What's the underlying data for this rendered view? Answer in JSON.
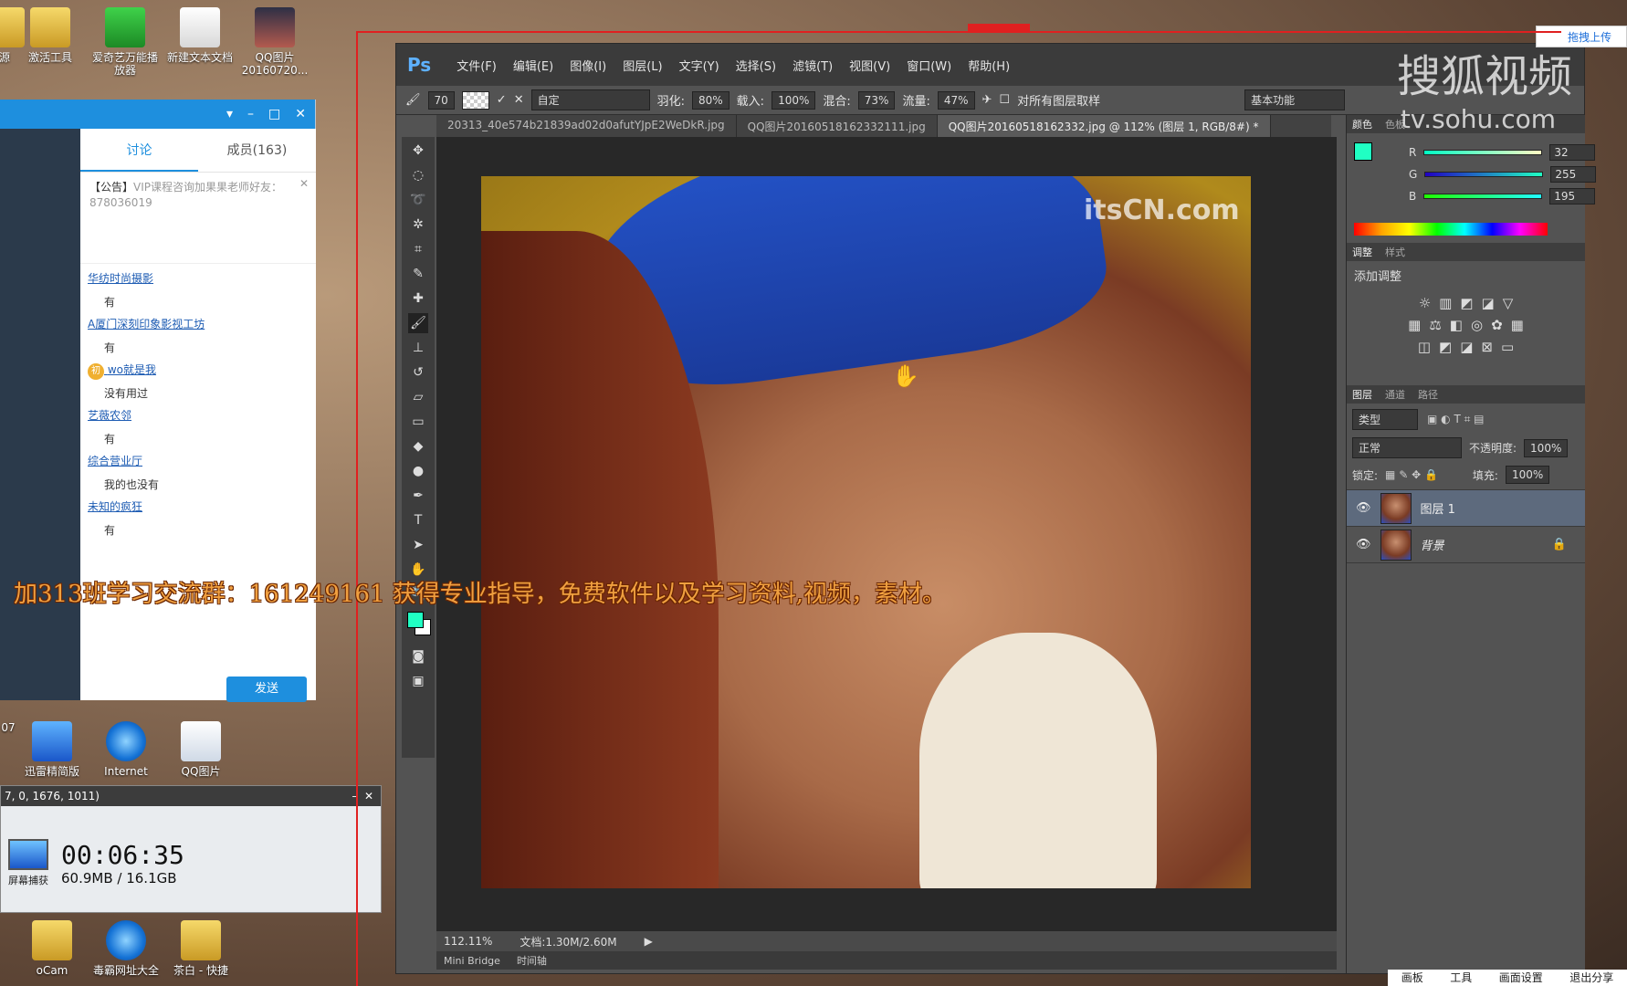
{
  "desktop": {
    "icons_top": [
      {
        "label": "源",
        "style": "folder"
      },
      {
        "label": "激活工具",
        "style": "folder"
      },
      {
        "label": "爱奇艺万能播放器",
        "style": "green"
      },
      {
        "label": "新建文本文档",
        "style": "doc"
      },
      {
        "label": "QQ图片20160720...",
        "style": "img"
      }
    ],
    "icons_mid": [
      {
        "label": "迅雷精简版",
        "style": "blue"
      },
      {
        "label": "Internet",
        "style": "ie"
      },
      {
        "label": "QQ图片",
        "style": "qq"
      }
    ],
    "icons_bottom": [
      {
        "label": "oCam",
        "style": "folder"
      },
      {
        "label": "毒霸网址大全",
        "style": "ie"
      },
      {
        "label": "茶白 - 快捷",
        "style": "folder"
      }
    ],
    "left_edge_label": "07"
  },
  "chat": {
    "tabs": [
      "讨论",
      "成员(163)"
    ],
    "notice_title": "【公告】",
    "notice_text": "VIP课程咨询加果果老师好友：878036019",
    "messages": [
      {
        "who": "华纺时尚摄影",
        "text": "有"
      },
      {
        "who": "A厦门深刻印象影视工坊",
        "text": "有"
      },
      {
        "who": "wo就是我",
        "text": "没有用过",
        "badge": "初"
      },
      {
        "who": "艺薇农邻",
        "text": "有"
      },
      {
        "who": "综合营业厅",
        "text": "我的也没有"
      },
      {
        "who": "未知的疯狂",
        "text": "有"
      }
    ],
    "send": "发送"
  },
  "promo": "加313班学习交流群：161249161 获得专业指导，免费软件以及学习资料,视频，素材。",
  "recorder": {
    "title": "7, 0, 1676, 1011)",
    "time": "00:06:35",
    "size": "60.9MB / 16.1GB",
    "icon_label": "屏幕捕获"
  },
  "ps": {
    "logo": "Ps",
    "menu": [
      "文件(F)",
      "编辑(E)",
      "图像(I)",
      "图层(L)",
      "文字(Y)",
      "选择(S)",
      "滤镜(T)",
      "视图(V)",
      "窗口(W)",
      "帮助(H)"
    ],
    "options": {
      "brush_size": "70",
      "preset": "自定",
      "feather_label": "羽化:",
      "feather": "80%",
      "load_label": "载入:",
      "load": "100%",
      "mix_label": "混合:",
      "mix": "73%",
      "flow_label": "流量:",
      "flow": "47%",
      "sample_all": "对所有图层取样",
      "workspace": "基本功能"
    },
    "doc_tabs": [
      "20313_40e574b21839ad02d0afutYJpE2WeDkR.jpg",
      "QQ图片20160518162332111.jpg",
      "QQ图片20160518162332.jpg @ 112% (图层 1, RGB/8#) *"
    ],
    "watermark": "itsCN.com",
    "zoom": "112.11%",
    "doc_size": "文档:1.30M/2.60M",
    "bottom_tabs": [
      "Mini Bridge",
      "时间轴"
    ],
    "color_panel": {
      "tabs": [
        "颜色",
        "色板"
      ],
      "r": "32",
      "g": "255",
      "b": "195",
      "fg_color": "#20ffc3"
    },
    "adjust_panel": {
      "tabs": [
        "调整",
        "样式"
      ],
      "title": "添加调整"
    },
    "layers_panel": {
      "tabs": [
        "图层",
        "通道",
        "路径"
      ],
      "kind": "类型",
      "blend": "正常",
      "opacity_label": "不透明度:",
      "opacity": "100%",
      "lock_label": "锁定:",
      "fill_label": "填充:",
      "fill": "100%",
      "layers": [
        {
          "name": "图层 1",
          "selected": true
        },
        {
          "name": "背景",
          "selected": false
        }
      ]
    }
  },
  "watermark_sohu": "搜狐视频",
  "watermark_sohu_url": "tv.sohu.com",
  "upload_badge": "拖拽上传",
  "taskbar_bottom": [
    "画板",
    "工具",
    "画面设置",
    "退出分享"
  ]
}
